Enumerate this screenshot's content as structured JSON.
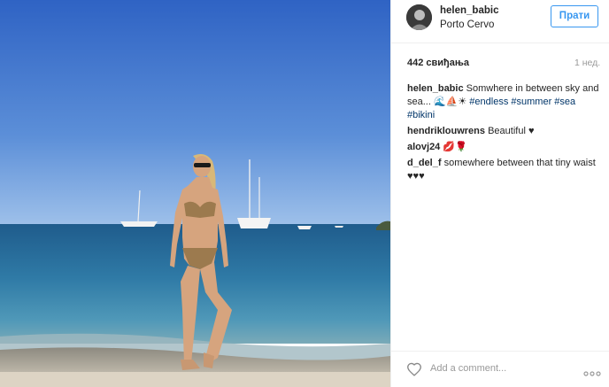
{
  "post": {
    "image_description_icon": "beach-photo"
  },
  "header": {
    "username": "helen_babic",
    "location": "Porto Cervo",
    "follow_label": "Прати"
  },
  "meta": {
    "likes": "442 свиђања",
    "time": "1 нед."
  },
  "comments": [
    {
      "user": "helen_babic",
      "text": " Somwhere in between sky and sea... 🌊⛵☀ ",
      "tags": [
        "#endless",
        "#summer",
        "#sea",
        "#bikini"
      ]
    },
    {
      "user": "hendriklouwrens",
      "text": " Beautiful ♥"
    },
    {
      "user": "alovj24",
      "text": " 💋🌹"
    },
    {
      "user": "d_del_f",
      "text": " somewhere between that tiny waist ♥♥♥"
    }
  ],
  "footer": {
    "placeholder": "Add a comment...",
    "like_icon": "heart-outline-icon",
    "more_icon": "ellipsis-icon"
  },
  "colors": {
    "accent": "#3897f0",
    "hashtag": "#003569",
    "muted": "#999999"
  }
}
